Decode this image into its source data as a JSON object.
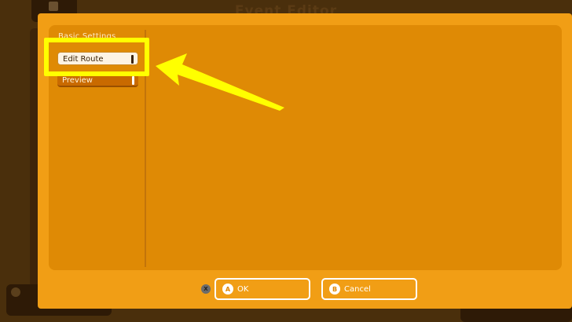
{
  "window": {
    "title": "Event Editor"
  },
  "sidebar": {
    "section_label": "Basic Settings",
    "items": [
      {
        "label": "Edit Route",
        "selected": true
      },
      {
        "label": "Preview",
        "selected": false
      }
    ]
  },
  "footer": {
    "x_glyph": "X",
    "ok": {
      "glyph": "A",
      "label": "OK"
    },
    "cancel": {
      "glyph": "B",
      "label": "Cancel"
    }
  },
  "colors": {
    "dialog": "#f19e15",
    "panel": "#df8a05",
    "highlight": "#ffff00",
    "selected_item": "#fdf3e3"
  }
}
